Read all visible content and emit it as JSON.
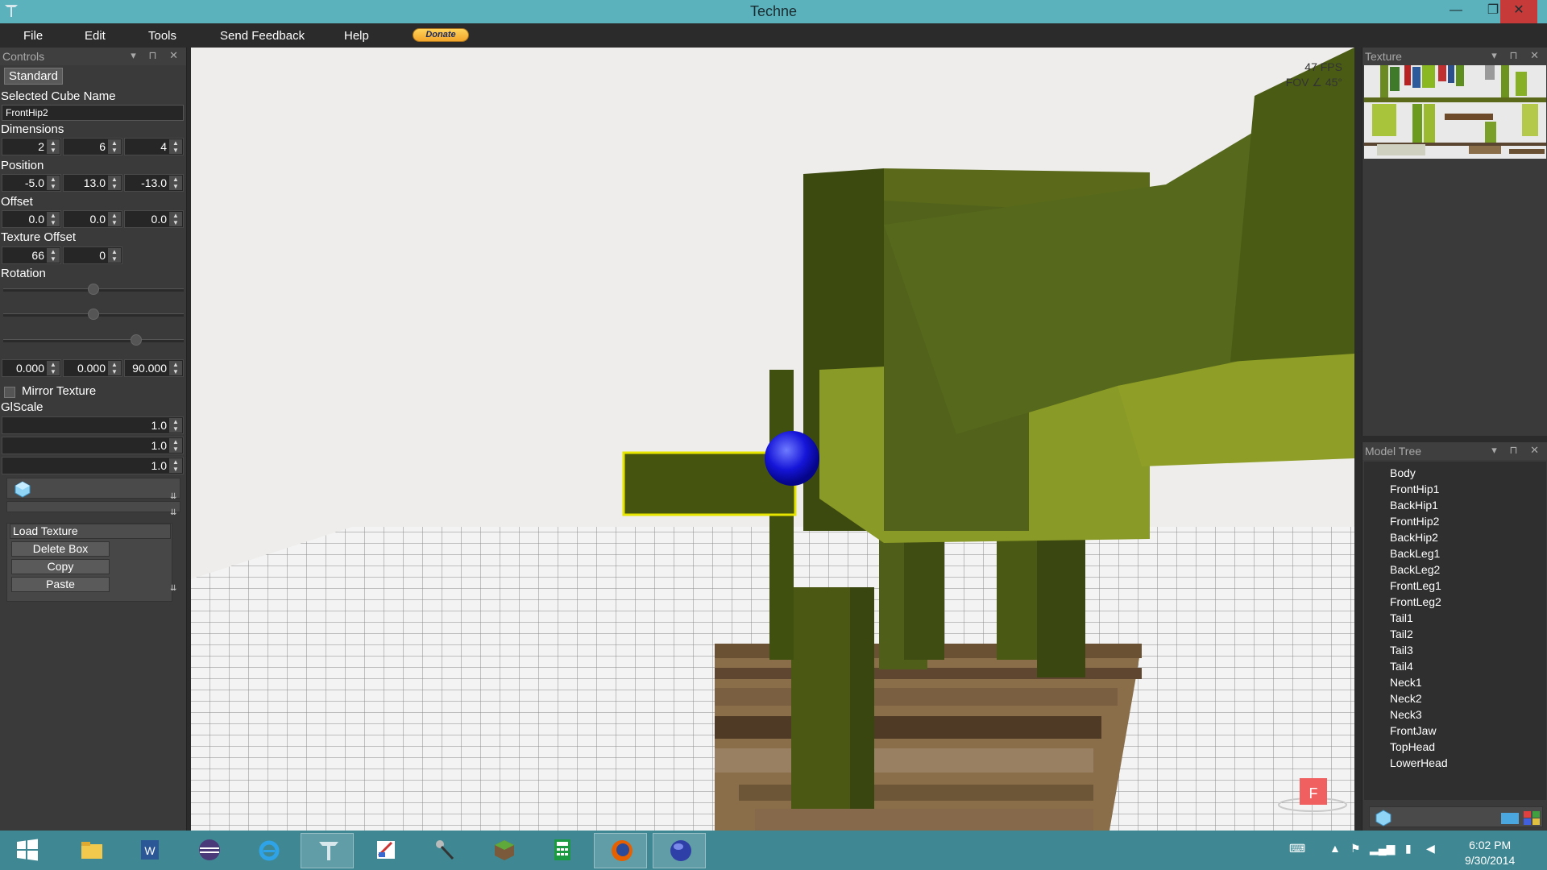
{
  "window": {
    "title": "Techne",
    "min_glyph": "—",
    "max_glyph": "❐",
    "close_glyph": "✕"
  },
  "menu": {
    "items": [
      "File",
      "Edit",
      "Tools",
      "Send Feedback",
      "Help"
    ],
    "donate_label": "Donate"
  },
  "controls": {
    "header": "Controls",
    "standard_label": "Standard",
    "cube_name_label": "Selected Cube Name",
    "cube_name_value": "FrontHip2",
    "dimensions_label": "Dimensions",
    "dimensions": [
      "2",
      "6",
      "4"
    ],
    "position_label": "Position",
    "position": [
      "-5.0",
      "13.0",
      "-13.0"
    ],
    "offset_label": "Offset",
    "offset": [
      "0.0",
      "0.0",
      "0.0"
    ],
    "texture_offset_label": "Texture Offset",
    "texture_offset": [
      "66",
      "0"
    ],
    "rotation_label": "Rotation",
    "rotation": [
      "0.000",
      "0.000",
      "90.000"
    ],
    "rotation_sliders": [
      0.5,
      0.5,
      0.75
    ],
    "mirror_label": "Mirror Texture",
    "glscale_label": "GlScale",
    "glscale": [
      "1.0",
      "1.0",
      "1.0"
    ],
    "buttons": {
      "load_texture": "Load Texture",
      "delete_box": "Delete Box",
      "copy": "Copy",
      "paste": "Paste"
    }
  },
  "viewport": {
    "fps": "47 FPS",
    "fov": "FOV ∠ 45°",
    "axis_marker": "F"
  },
  "texture_panel": {
    "header": "Texture"
  },
  "model_tree": {
    "header": "Model Tree",
    "items": [
      "Body",
      "FrontHip1",
      "BackHip1",
      "FrontHip2",
      "BackHip2",
      "BackLeg1",
      "BackLeg2",
      "FrontLeg1",
      "FrontLeg2",
      "Tail1",
      "Tail2",
      "Tail3",
      "Tail4",
      "Neck1",
      "Neck2",
      "Neck3",
      "FrontJaw",
      "TopHead",
      "LowerHead"
    ]
  },
  "taskbar": {
    "apps": [
      "start-icon",
      "file-explorer-icon",
      "word-icon",
      "eclipse-icon",
      "internet-explorer-icon",
      "techne-icon",
      "paint-icon",
      "microphone-icon",
      "minecraft-icon",
      "calculator-icon",
      "firefox-icon",
      "java-icon"
    ],
    "time": "6:02 PM",
    "date": "9/30/2014"
  }
}
